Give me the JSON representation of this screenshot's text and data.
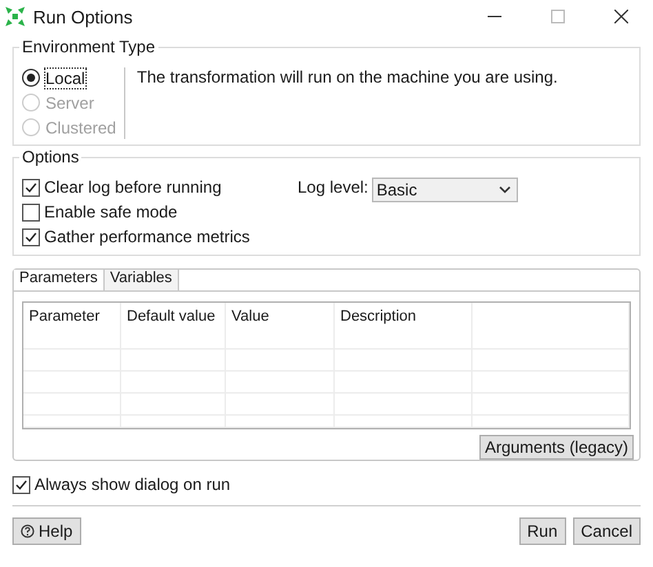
{
  "window": {
    "title": "Run Options"
  },
  "environment": {
    "title": "Environment Type",
    "options": [
      {
        "label": "Local",
        "selected": true,
        "disabled": false
      },
      {
        "label": "Server",
        "selected": false,
        "disabled": true
      },
      {
        "label": "Clustered",
        "selected": false,
        "disabled": true
      }
    ],
    "description": "The transformation will run on the machine you are using."
  },
  "options": {
    "title": "Options",
    "checkboxes": [
      {
        "label": "Clear log before running",
        "checked": true
      },
      {
        "label": "Enable safe mode",
        "checked": false
      },
      {
        "label": "Gather performance metrics",
        "checked": true
      }
    ],
    "log_level": {
      "label": "Log level:",
      "value": "Basic"
    }
  },
  "tabs": [
    {
      "label": "Parameters",
      "selected": true
    },
    {
      "label": "Variables",
      "selected": false
    }
  ],
  "table": {
    "columns": [
      "Parameter",
      "Default value",
      "Value",
      "Description"
    ]
  },
  "arguments_button": "Arguments (legacy)",
  "always_show": {
    "label": "Always show dialog on run",
    "checked": true
  },
  "buttons": {
    "help": "Help",
    "run": "Run",
    "cancel": "Cancel"
  }
}
